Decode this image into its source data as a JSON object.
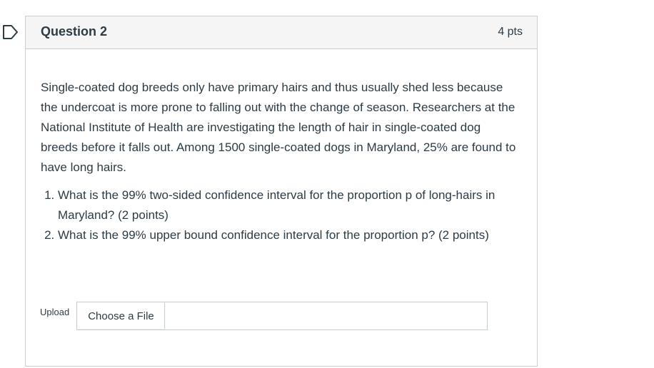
{
  "question": {
    "title": "Question 2",
    "points": "4 pts",
    "flag_icon": "flag-outline-icon",
    "accent_color": "#2d3b45",
    "intro": "Single-coated dog breeds only have primary hairs and thus usually shed less because the undercoat is more prone to falling out with the change of season. Researchers at the National Institute of Health are investigating the length of hair in single-coated dog breeds before it falls out. Among 1500 single-coated dogs in Maryland, 25% are found to have long hairs.",
    "items": [
      {
        "text": "What is the 99% two-sided confidence interval for the proportion p of long-hairs in Maryland? (2 points)"
      },
      {
        "text": "What is the 99% upper bound confidence interval for the proportion p? (2 points)"
      }
    ]
  },
  "upload": {
    "label": "Upload",
    "button_label": "Choose a File"
  }
}
